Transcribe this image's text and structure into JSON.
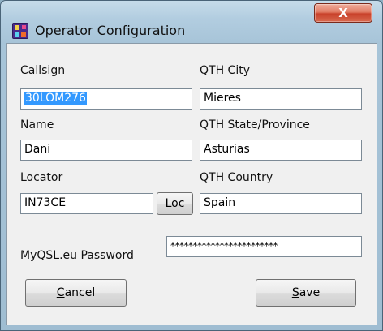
{
  "window": {
    "title": "Operator Configuration",
    "close_glyph": "X",
    "app_icon": "app-logo-icon",
    "close_icon": "close-icon"
  },
  "form": {
    "callsign": {
      "label": "Callsign",
      "value": "30LOM276",
      "selected": true
    },
    "qth_city": {
      "label": "QTH City",
      "value": "Mieres"
    },
    "name": {
      "label": "Name",
      "value": "Dani"
    },
    "qth_state": {
      "label": "QTH State/Province",
      "value": "Asturias"
    },
    "locator": {
      "label": "Locator",
      "value": "IN73CE"
    },
    "loc_button": {
      "label": "Loc"
    },
    "qth_country": {
      "label": "QTH Country",
      "value": "Spain"
    },
    "password": {
      "label": "MyQSL.eu Password",
      "value": "************************"
    }
  },
  "buttons": {
    "cancel": {
      "mnemonic": "C",
      "rest": "ancel"
    },
    "save": {
      "mnemonic": "S",
      "rest": "ave"
    }
  },
  "colors": {
    "selection": "#3399ff",
    "close_button": "#c8412a",
    "dialog_background": "#f0f0f0"
  }
}
